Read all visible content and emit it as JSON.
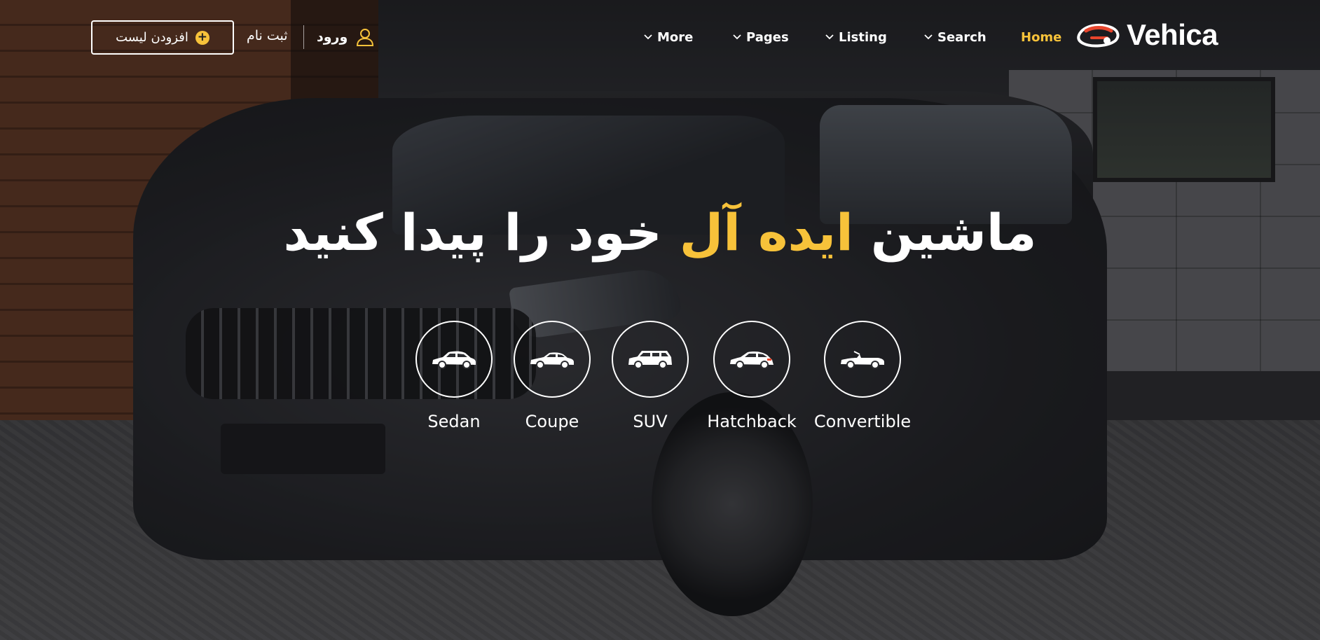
{
  "header": {
    "add_listing_label": "افزودن لیست",
    "register_label": "ثبت نام",
    "login_label": "ورود",
    "logo_text": "Vehica",
    "nav": [
      {
        "label": "More",
        "has_dropdown": true
      },
      {
        "label": "Pages",
        "has_dropdown": true
      },
      {
        "label": "Listing",
        "has_dropdown": true
      },
      {
        "label": "Search",
        "has_dropdown": true
      },
      {
        "label": "Home",
        "has_dropdown": false,
        "active": true
      }
    ]
  },
  "hero": {
    "headline_part1": "ماشین ",
    "headline_accent": "ایده آل",
    "headline_part2": " خود را پیدا کنید"
  },
  "categories": [
    {
      "label": "Sedan",
      "icon": "sedan-icon"
    },
    {
      "label": "Coupe",
      "icon": "coupe-icon"
    },
    {
      "label": "SUV",
      "icon": "suv-icon"
    },
    {
      "label": "Hatchback",
      "icon": "hatchback-icon"
    },
    {
      "label": "Convertible",
      "icon": "convertible-icon"
    }
  ],
  "colors": {
    "accent": "#f7c23a",
    "logo_red": "#e8452c",
    "text": "#ffffff"
  }
}
